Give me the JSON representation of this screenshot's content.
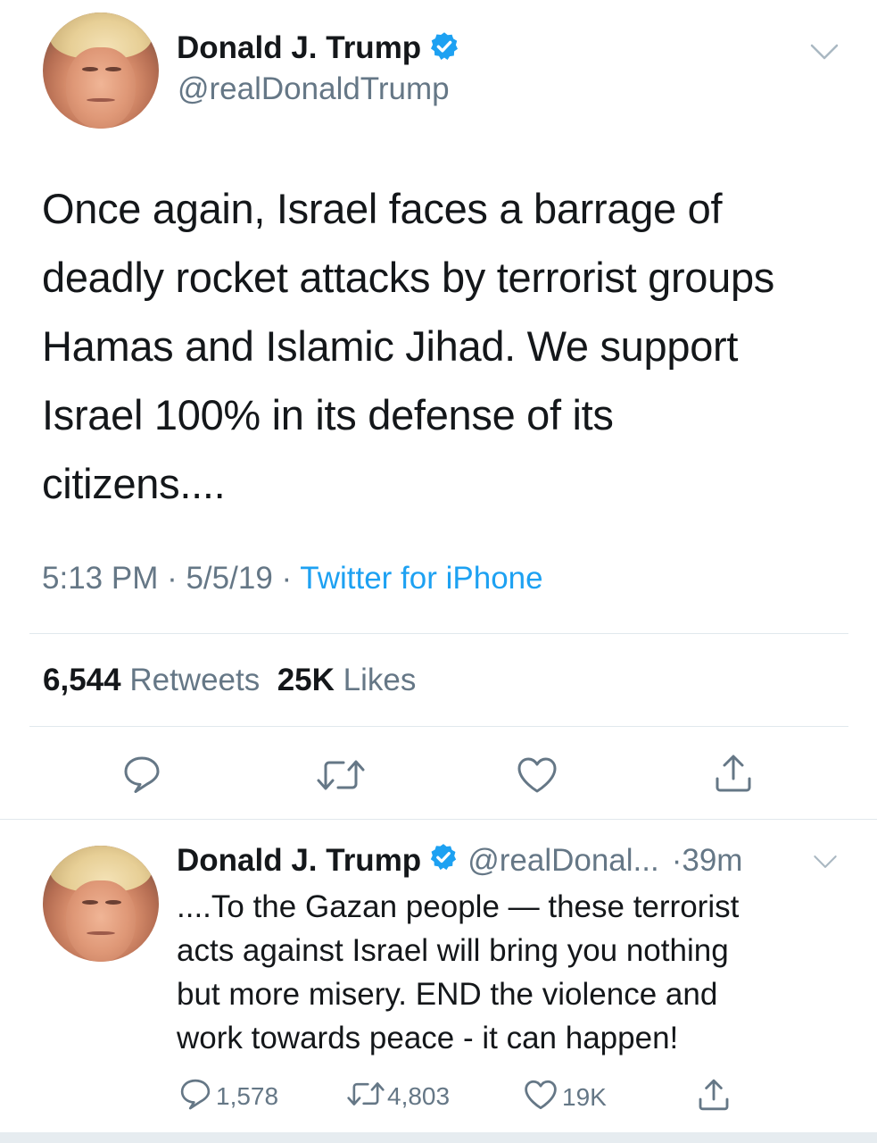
{
  "main_tweet": {
    "author_name": "Donald J. Trump",
    "handle": "@realDonaldTrump",
    "verified_icon": "verified-badge-icon",
    "text_lines": [
      "Once again, Israel faces a barrage of",
      "deadly rocket attacks by terrorist groups",
      "Hamas and Islamic Jihad. We support",
      "Israel 100% in its defense of its",
      "citizens...."
    ],
    "time": "5:13 PM",
    "date": "5/5/19",
    "source": "Twitter for iPhone",
    "retweet_count": "6,544",
    "retweet_label": "Retweets",
    "like_count": "25K",
    "like_label": "Likes",
    "actions": [
      "reply-icon",
      "retweet-icon",
      "like-icon",
      "share-icon"
    ]
  },
  "reply_tweet": {
    "author_name": "Donald J. Trump",
    "handle": "@realDonal...",
    "time": "39m",
    "text_lines": [
      "....To the Gazan people — these terrorist",
      "acts against Israel will bring you nothing",
      "but more misery. END the violence and",
      "work towards peace - it can happen!"
    ],
    "reply_count": "1,578",
    "retweet_count": "4,803",
    "like_count": "19K"
  },
  "colors": {
    "accent": "#1da1f2",
    "text": "#14171a",
    "muted": "#657786",
    "divider": "#e1e8ed"
  }
}
